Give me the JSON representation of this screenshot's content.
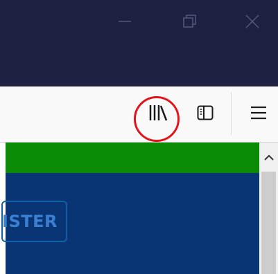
{
  "window_controls": {
    "minimize_icon": "minimize-icon",
    "restore_icon": "restore-icon",
    "close_icon": "close-icon"
  },
  "toolbar": {
    "library_icon": "library-icon",
    "sidebar_icon": "sidebar-icon",
    "menu_icon": "hamburger-menu-icon"
  },
  "page": {
    "register_label": "ISTER"
  },
  "colors": {
    "titlebar": "#1f2143",
    "toolbar": "#f9f9fa",
    "highlight": "#e3131a",
    "green_bar": "#0b8a06",
    "blue_panel": "#0a3574",
    "register_text": "#3b7fd3"
  }
}
